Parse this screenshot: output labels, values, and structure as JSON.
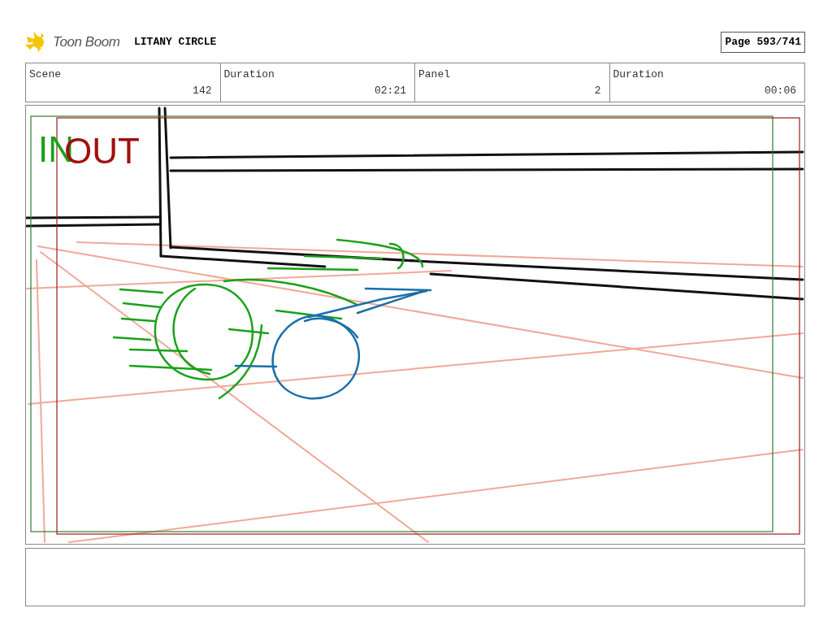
{
  "header": {
    "logo_text": "Toon Boom",
    "title": "LITANY CIRCLE",
    "page_label": "Page 593/741"
  },
  "info": [
    {
      "label": "Scene",
      "value": "142"
    },
    {
      "label": "Duration",
      "value": "02:21"
    },
    {
      "label": "Panel",
      "value": "2"
    },
    {
      "label": "Duration",
      "value": "00:06"
    }
  ],
  "panel": {
    "in_label": "IN",
    "out_label": "OUT"
  }
}
